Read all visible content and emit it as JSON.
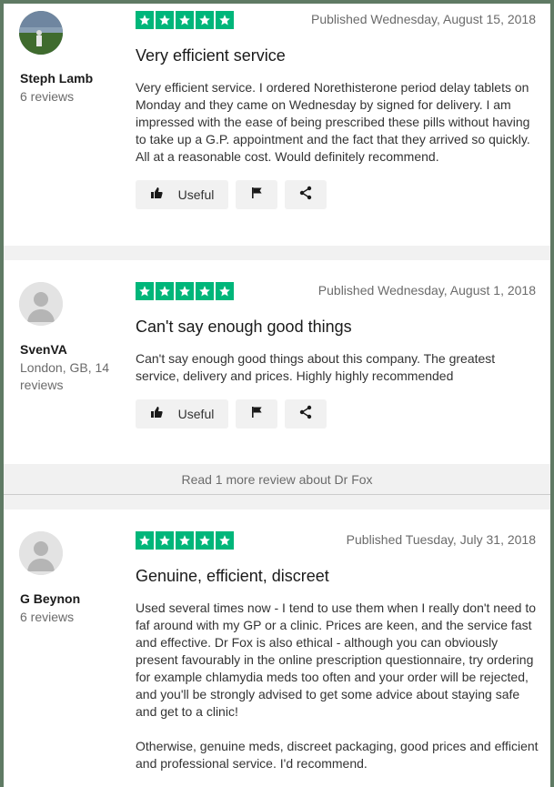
{
  "colors": {
    "star_green": "#00b67a",
    "divider_gray": "#f1f1f1"
  },
  "reviews": [
    {
      "user_name": "Steph Lamb",
      "user_meta": "6 reviews",
      "rating": 5,
      "published": "Published Wednesday, August 15, 2018",
      "title": "Very efficient service",
      "body": [
        "Very efficient service. I ordered Norethisterone period delay tablets on Monday and they came on Wednesday by signed for delivery. I am impressed with the ease of being prescribed these pills without having to take up a G.P. appointment and the fact that they arrived so quickly. All at a reasonable cost. Would definitely recommend."
      ],
      "useful_label": "Useful"
    },
    {
      "user_name": "SvenVA",
      "user_meta": "London, GB, 14 reviews",
      "rating": 5,
      "published": "Published Wednesday, August 1, 2018",
      "title": "Can't say enough good things",
      "body": [
        "Can't say enough good things about this company. The greatest service, delivery and prices. Highly highly recommended"
      ],
      "useful_label": "Useful"
    },
    {
      "user_name": "G Beynon",
      "user_meta": "6 reviews",
      "rating": 5,
      "published": "Published Tuesday, July 31, 2018",
      "title": "Genuine, efficient, discreet",
      "body": [
        "Used several times now - I tend to use them when I really don't need to faf around with my GP or a clinic. Prices are keen, and the service fast and effective. Dr Fox is also ethical - although you can obviously present favourably in the online prescription questionnaire, try ordering for example chlamydia meds too often and your order will be rejected, and you'll be strongly advised to get some advice about staying safe and get to a clinic!",
        "Otherwise, genuine meds, discreet packaging, good prices and efficient and professional service. I'd recommend."
      ]
    }
  ],
  "more_reviews_link": "Read 1 more review about Dr Fox"
}
